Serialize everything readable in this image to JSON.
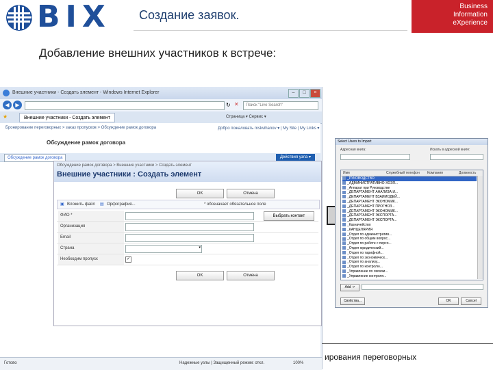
{
  "slide": {
    "logo_text": "BIX",
    "title": "Создание заявок.",
    "brand_lines": [
      "Business",
      "Information",
      "eXperience"
    ],
    "subtitle": "Добавление внешних участников к встрече:",
    "footer_text": "ирования переговорных"
  },
  "browser": {
    "window_title": "Внешние участники - Создать элемент - Windows Internet Explorer",
    "address": "",
    "search_placeholder": "Поиск \"Live Search\"",
    "tab_label": "Внешние участники - Создать элемент",
    "tools": "Страница ▾  Сервис ▾",
    "breadcrumb": "Бронирование переговорных > заказ пропусков > Обсуждение рамок договора",
    "welcome": "Добро пожаловать mskvihanov ▾  |  My Site  |  My Links ▾",
    "site_title": "Обсуждение рамок договора",
    "nav_tab": "Обсуждение рамок договора",
    "actions_label": "Действия узла ▾",
    "status_left": "Готово",
    "status_zone": "Надежные узлы | Защищенный режим: откл.",
    "status_zoom": "100%"
  },
  "form": {
    "breadcrumb": "Обсуждение рамок договора > Внешние участники > Создать элемент",
    "title": "Внешние участники : Создать элемент",
    "ok_label": "OK",
    "cancel_label": "Отмена",
    "toolbar_attach": "Вложить файл",
    "toolbar_spelling": "Орфография...",
    "required_note": "* обозначает обязательное поле",
    "pick_contact": "Выбрать контакт",
    "fields": [
      {
        "label": "ФИО *"
      },
      {
        "label": "Организация"
      },
      {
        "label": "Email"
      },
      {
        "label": "Страна"
      },
      {
        "label": "Необходим пропуск"
      }
    ]
  },
  "picker": {
    "title": "Select Users to Import",
    "label_left": "Адресная книга:",
    "label_right": "Искать в адресной книге:",
    "columns": [
      "Имя",
      "Служебный телефон",
      "Компания",
      "Должность"
    ],
    "items": [
      "_РУКОВОДСТВО",
      "_АДМИНИСТРАТИВНО-ХОЗЯ...",
      "_Аппарат при Руководстве",
      "_ДЕПАРТАМЕНТ АНАЛИЗА И...",
      "_ДЕПАРТАМЕНТ ВЗАИМОДЕЙ...",
      "_ДЕПАРТАМЕНТ ЭКОНОМИК...",
      "_ДЕПАРТАМЕНТ ПРОГНОЗ...",
      "_ДЕПАРТАМЕНТ ЭКОНОМИК...",
      "_ДЕПАРТАМЕНТ ЭКСПОРТА...",
      "_ДЕПАРТАМЕНТ ЭКСПОРТА...",
      "_Казначейство",
      "_КАНЦЕЛЯРИЯ",
      "_Отдел по административ...",
      "_Отдел по общим вопрос...",
      "_Отдел по работе с персо...",
      "_Отдел юридический...",
      "_Отдел по тарифной...",
      "_Отдел по экономическ...",
      "_Отдел по анализу...",
      "_Отдел по контролю...",
      "_Управление по связям...",
      "_Управление контроля..."
    ],
    "add_label": "Add ->",
    "ok_label": "OK",
    "cancel_label": "Cancel",
    "props_label": "Свойства..."
  }
}
